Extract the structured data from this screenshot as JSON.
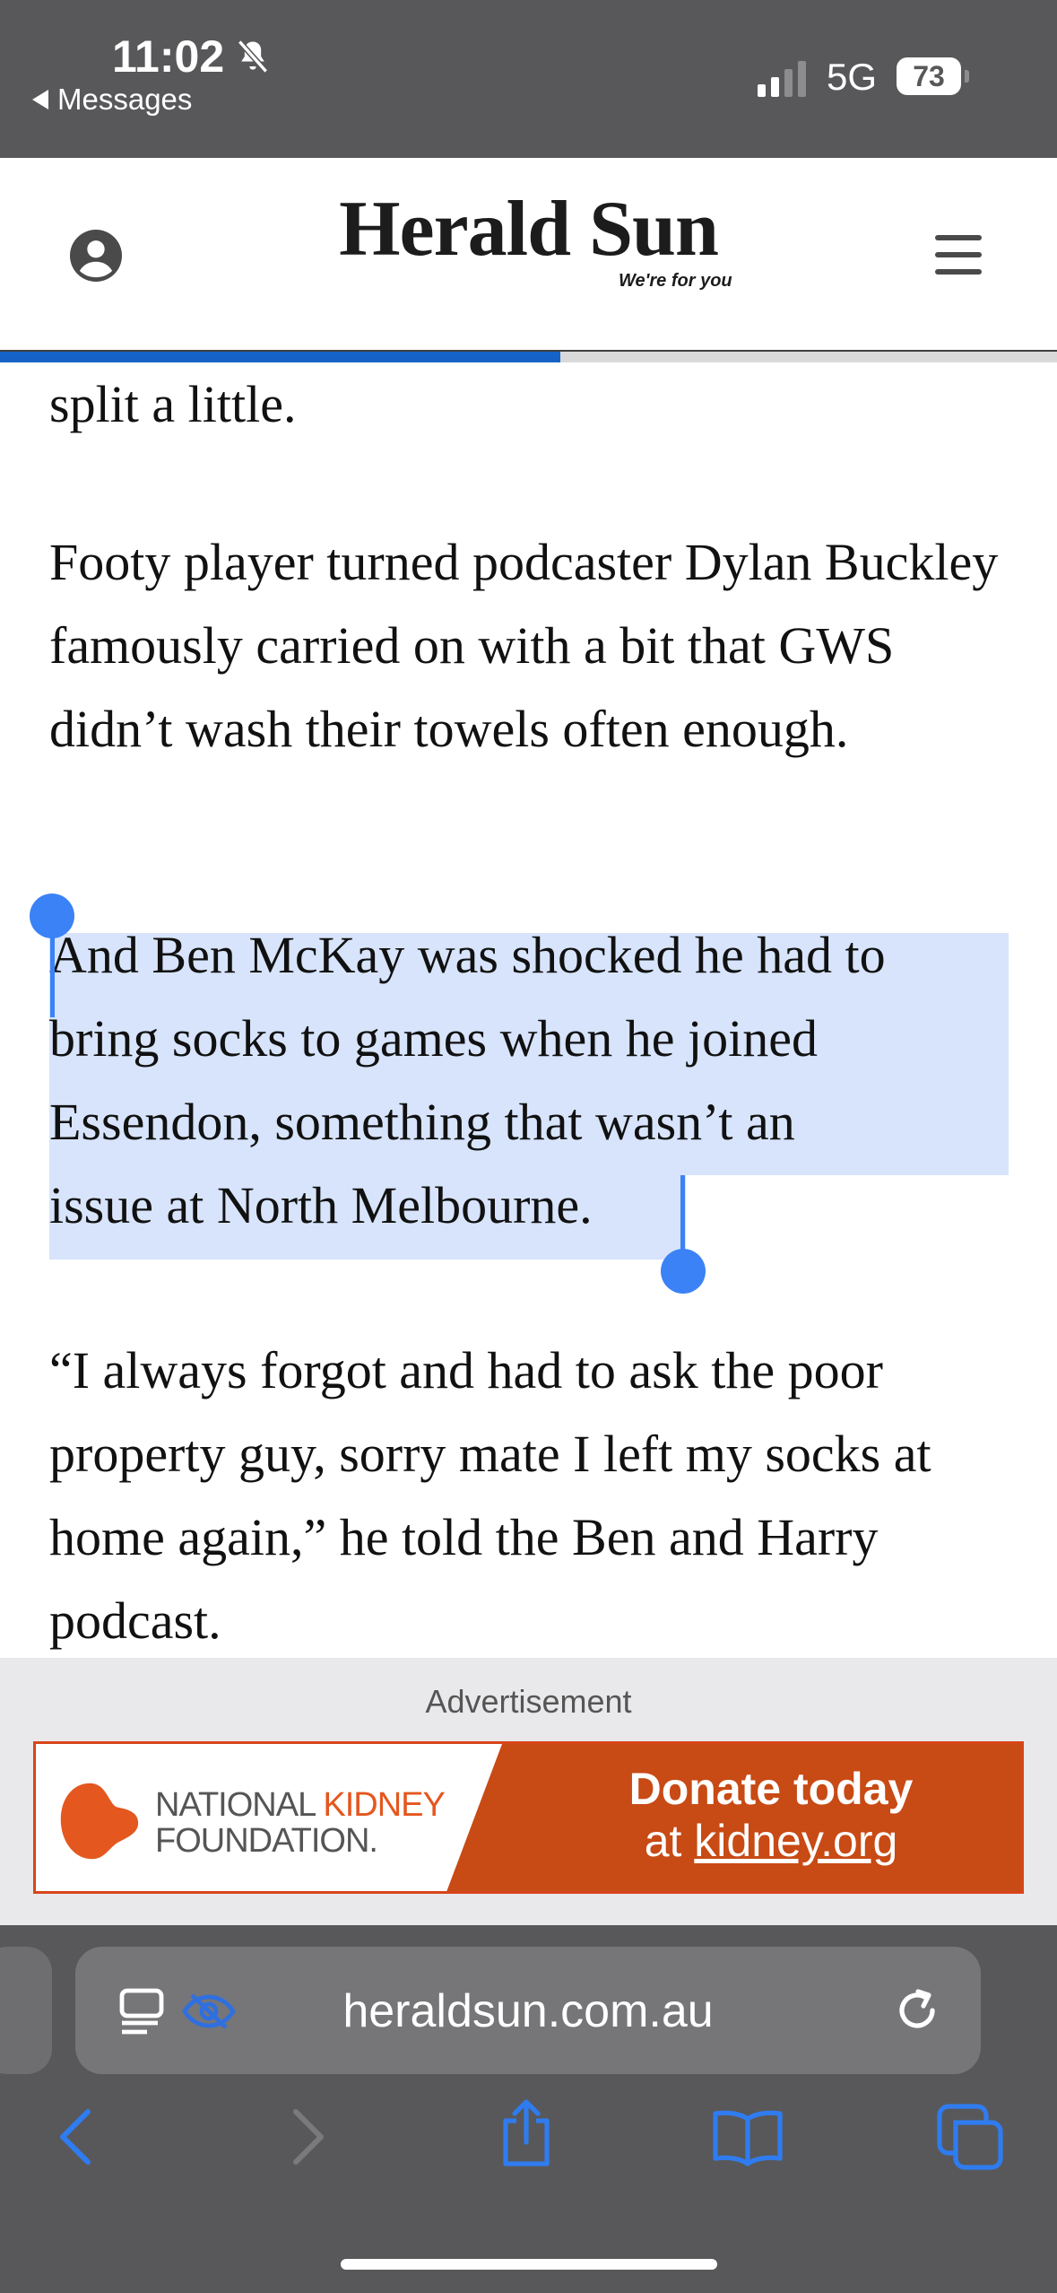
{
  "status_bar": {
    "time": "11:02",
    "back_label": "Messages",
    "network": "5G",
    "battery": "73"
  },
  "header": {
    "logo": "Herald Sun",
    "tagline": "We're for you",
    "reading_progress": 0.53
  },
  "article": {
    "paragraphs": [
      "split a little.",
      "Footy player turned podcaster Dylan Buckley famously carried on with a bit that GWS didn’t wash their towels often enough.",
      "And Ben McKay was shocked he had to bring socks to games when he joined Essendon, something that wasn’t an issue at North Melbourne.",
      "“I always forgot and had to ask the poor property guy, sorry mate I left my socks at home again,” he told the Ben and Harry podcast."
    ],
    "selected_lines": [
      "And Ben McKay was shocked he had to",
      "bring socks to games when he joined",
      "Essendon, something that wasn’t an",
      "issue at North Melbourne."
    ]
  },
  "advertisement": {
    "label": "Advertisement",
    "org_line1_a": "NATIONAL ",
    "org_line1_b": "KIDNEY",
    "org_line2": "FOUNDATION.",
    "cta_line1": "Donate today",
    "cta_line2_prefix": "at ",
    "cta_line2_link": "kidney.org",
    "brand_color": "#c84a14"
  },
  "browser": {
    "url": "heraldsun.com.au",
    "icons": [
      "reader-icon",
      "eye-icon",
      "reload-icon",
      "back-icon",
      "forward-icon",
      "share-icon",
      "bookmarks-icon",
      "tabs-icon"
    ]
  }
}
